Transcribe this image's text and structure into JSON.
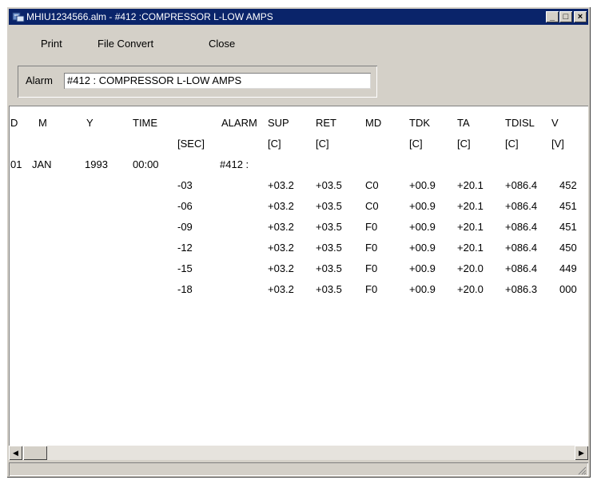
{
  "window": {
    "title": "MHIU1234566.alm - #412 :COMPRESSOR L-LOW AMPS"
  },
  "titlebar_buttons": {
    "minimize": "_",
    "maximize": "□",
    "close": "×"
  },
  "menu": {
    "print": "Print",
    "file_convert": "File Convert",
    "close": "Close"
  },
  "alarm": {
    "label": "Alarm",
    "value": "#412 :  COMPRESSOR L-LOW AMPS"
  },
  "table": {
    "header1": [
      "D",
      "M",
      "Y",
      "TIME",
      "ALARM",
      "SUP",
      "RET",
      "MD",
      "TDK",
      "TA",
      "TDISL",
      "V"
    ],
    "header2": [
      "",
      "",
      "",
      "",
      "[SEC]",
      "[C]",
      "[C]",
      "",
      "[C]",
      "[C]",
      "[C]",
      "[V]"
    ],
    "event": {
      "day": "01",
      "month": "JAN",
      "year": "1993",
      "time": "00:00",
      "alarm": "#412 :"
    },
    "rows": [
      {
        "sec": "-03",
        "sup": "+03.2",
        "ret": "+03.5",
        "md": "C0",
        "tdk": "+00.9",
        "ta": "+20.1",
        "tdisl": "+086.4",
        "v": "452"
      },
      {
        "sec": "-06",
        "sup": "+03.2",
        "ret": "+03.5",
        "md": "C0",
        "tdk": "+00.9",
        "ta": "+20.1",
        "tdisl": "+086.4",
        "v": "451"
      },
      {
        "sec": "-09",
        "sup": "+03.2",
        "ret": "+03.5",
        "md": "F0",
        "tdk": "+00.9",
        "ta": "+20.1",
        "tdisl": "+086.4",
        "v": "451"
      },
      {
        "sec": "-12",
        "sup": "+03.2",
        "ret": "+03.5",
        "md": "F0",
        "tdk": "+00.9",
        "ta": "+20.1",
        "tdisl": "+086.4",
        "v": "450"
      },
      {
        "sec": "-15",
        "sup": "+03.2",
        "ret": "+03.5",
        "md": "F0",
        "tdk": "+00.9",
        "ta": "+20.0",
        "tdisl": "+086.4",
        "v": "449"
      },
      {
        "sec": "-18",
        "sup": "+03.2",
        "ret": "+03.5",
        "md": "F0",
        "tdk": "+00.9",
        "ta": "+20.0",
        "tdisl": "+086.3",
        "v": "000"
      }
    ]
  },
  "scrollbar": {
    "left": "◀",
    "right": "▶"
  }
}
